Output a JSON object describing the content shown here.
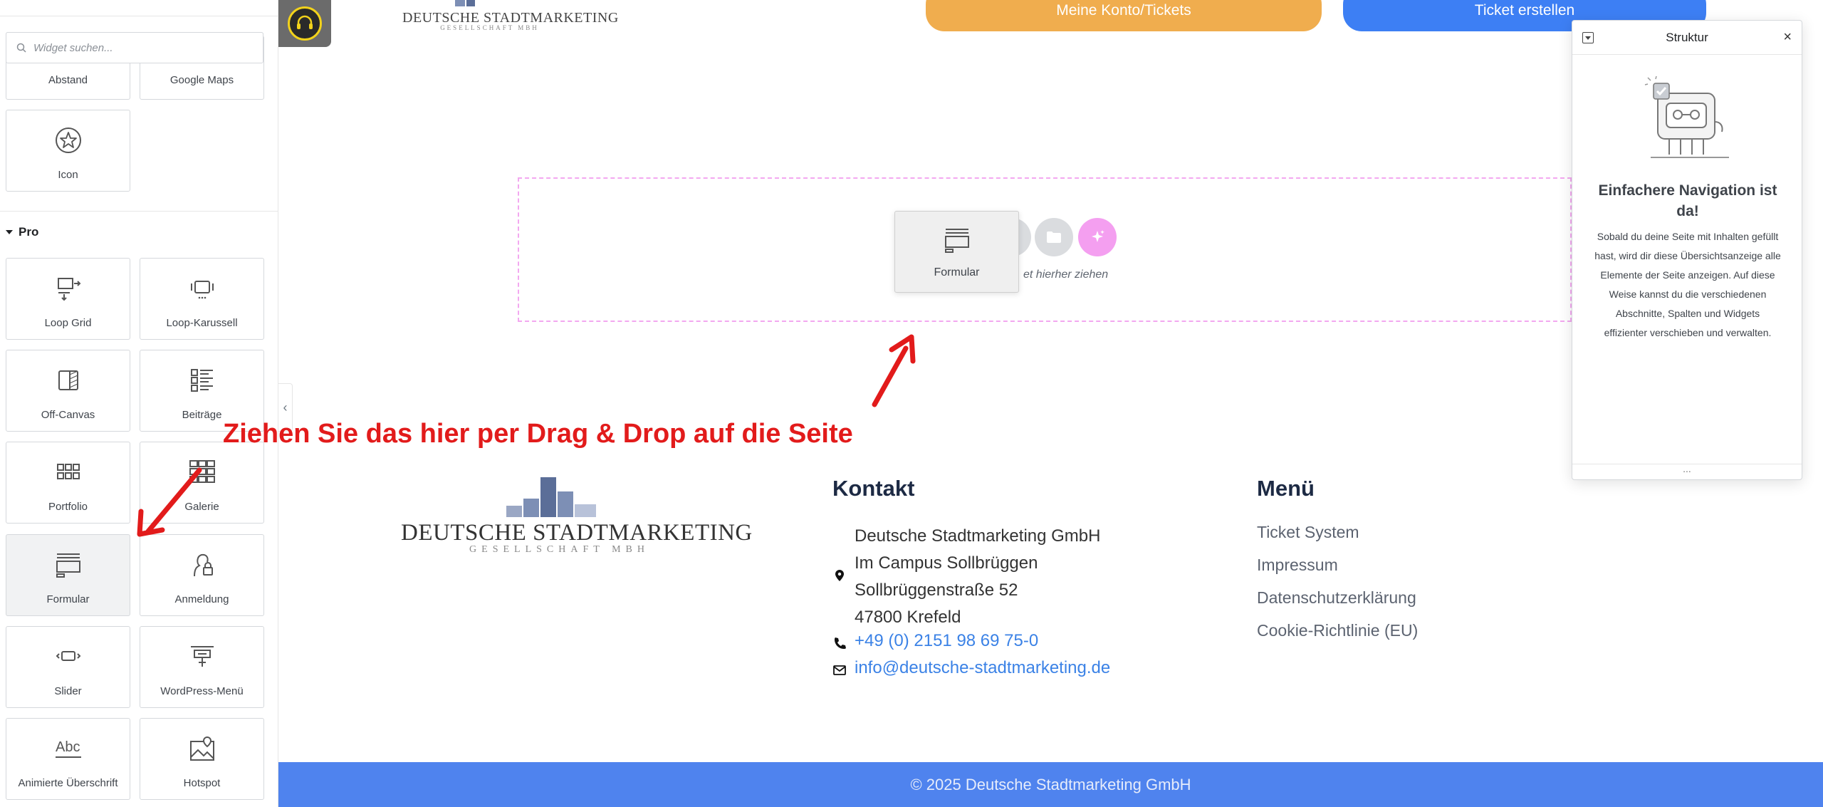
{
  "panel": {
    "search_placeholder": "Widget suchen...",
    "basic_tiles": [
      {
        "label": "Abstand",
        "icon": "spacer-icon"
      },
      {
        "label": "Google Maps",
        "icon": "map-icon"
      },
      {
        "label": "Icon",
        "icon": "star-icon"
      }
    ],
    "pro_title": "Pro",
    "pro_tiles": [
      {
        "label": "Loop Grid",
        "icon": "loop-grid-icon"
      },
      {
        "label": "Loop-Karussell",
        "icon": "loop-carousel-icon"
      },
      {
        "label": "Off-Canvas",
        "icon": "off-canvas-icon"
      },
      {
        "label": "Beiträge",
        "icon": "posts-icon"
      },
      {
        "label": "Portfolio",
        "icon": "portfolio-icon"
      },
      {
        "label": "Galerie",
        "icon": "gallery-icon"
      },
      {
        "label": "Formular",
        "icon": "form-icon"
      },
      {
        "label": "Anmeldung",
        "icon": "login-icon"
      },
      {
        "label": "Slider",
        "icon": "slider-icon"
      },
      {
        "label": "WordPress-Menü",
        "icon": "nav-menu-icon"
      },
      {
        "label": "Animierte Überschrift",
        "icon": "animated-headline-icon"
      },
      {
        "label": "Hotspot",
        "icon": "hotspot-icon"
      }
    ]
  },
  "header": {
    "logo_title": "DEUTSCHE STADTMARKETING",
    "logo_subtitle": "GESELLSCHAFT MBH",
    "account_button": "Meine Konto/Tickets",
    "ticket_button": "Ticket erstellen"
  },
  "dropzone": {
    "dragged_widget": "Formular",
    "hint": "et hierher ziehen"
  },
  "annotation": "Ziehen Sie das hier per Drag & Drop auf die Seite",
  "footer": {
    "logo_title": "DEUTSCHE STADTMARKETING",
    "logo_subtitle": "GESELLSCHAFT MBH",
    "contact_title": "Kontakt",
    "address_lines": [
      "Deutsche Stadtmarketing GmbH",
      "Im Campus Sollbrüggen",
      "Sollbrüggenstraße 52",
      "47800 Krefeld"
    ],
    "phone": "+49 (0) 2151 98 69 75-0",
    "email": "info@deutsche-stadtmarketing.de",
    "menu_title": "Menü",
    "menu_items": [
      "Ticket System",
      "Impressum",
      "Datenschutzerklärung",
      "Cookie-Richtlinie (EU)"
    ],
    "copyright": "© 2025 Deutsche Stadtmarketing GmbH"
  },
  "structure_panel": {
    "title": "Struktur",
    "heading": "Einfachere Navigation ist da!",
    "body": "Sobald du deine Seite mit Inhalten gefüllt hast, wird dir diese Übersichtsanzeige alle Elemente der Seite anzeigen. Auf diese Weise kannst du die verschiedenen Abschnitte, Spalten und Widgets effizienter verschieben und verwalten.",
    "footer_glyph": "..."
  },
  "colors": {
    "accent_orange": "#f0ad4e",
    "accent_blue": "#3d7ff4",
    "annotation_red": "#e21b1b",
    "footer_bar": "#4f83ee",
    "dropzone_border": "#f3a8f0"
  }
}
